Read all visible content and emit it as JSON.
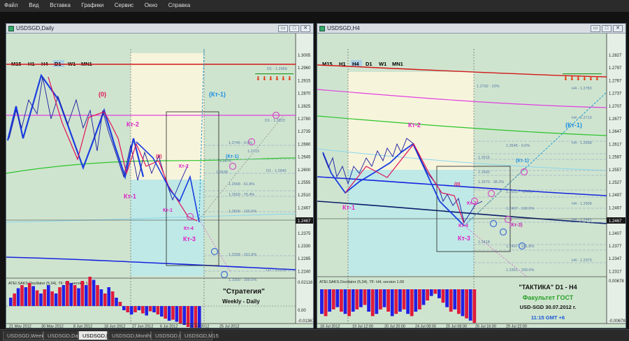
{
  "menu": [
    "Файл",
    "Вид",
    "Вставка",
    "Графики",
    "Сервис",
    "Окно",
    "Справка"
  ],
  "left_window": {
    "title": "USDSGD,Daily",
    "timeframes": [
      "M15",
      "H1",
      "H4",
      "D1",
      "W1",
      "MN1"
    ],
    "selected_tf": "D1",
    "price_labels": [
      "1.3005",
      "1.2960",
      "1.2915",
      "1.2870",
      "1.2825",
      "1.2780",
      "1.2735",
      "1.2690",
      "1.2645",
      "1.2600",
      "1.2555",
      "1.2510",
      "1.2467",
      "1.2420",
      "1.2375",
      "1.2330",
      "1.2285",
      "1.2240"
    ],
    "current_price": "1.2467",
    "date_labels": [
      "21 May 2012",
      "30 May 2012",
      "8 Jun 2012",
      "18 Jun 2012",
      "27 Jun 2012",
      "6 Jul 2012",
      "16 Jul 2012",
      "25 Jul 2012"
    ],
    "wave_labels": {
      "zero_top": "(0)",
      "kt2": "Кт-2",
      "zero_mid": "(0)",
      "kt2_small": "Кт-2",
      "kt1": "Кт-1",
      "kt1_small": "Кт-1",
      "kt3": "Кт-3",
      "kt4": "Кт-4",
      "kt1_bracket": "(Кт-1)",
      "kt1_bracket_small": "(Кт-1)"
    },
    "level_texts": [
      "D1 - 1.2969",
      "D1 - 1.2823",
      "1.2746 - 0.0%",
      "1.2713",
      "1.2676",
      "1.2638",
      "D1 - 1.2640",
      "1.2568 - 61.8%",
      "1.2563 - 76.4%",
      "1.2500 - 100.0%",
      "1.2358 - 161.8%",
      "D1 - 1.2296",
      "1.2300 - 200.0%"
    ],
    "osc_title": "ATEI.SAKS.Oscillator (5,34), TF: D1, version 1.00",
    "osc_scale": [
      "0.02116",
      "0.00",
      "-0.01367"
    ],
    "strategy_line1": "\"Стратегия\"",
    "strategy_line2": "Weekly - Daily"
  },
  "right_window": {
    "title": "USDSGD,H4",
    "timeframes": [
      "M15",
      "H1",
      "H4",
      "D1",
      "W1",
      "MN1"
    ],
    "selected_tf": "H4",
    "price_labels": [
      "1.2827",
      "1.2797",
      "1.2767",
      "1.2737",
      "1.2707",
      "1.2677",
      "1.2647",
      "1.2617",
      "1.2587",
      "1.2557",
      "1.2527",
      "1.2497",
      "1.2467",
      "1.2437",
      "1.2407",
      "1.2377",
      "1.2347",
      "1.2317"
    ],
    "current_price": "1.2467",
    "date_labels": [
      "18 Jul 2012",
      "19 Jul 12:00",
      "20 Jul 20:00",
      "24 Jul 08:00",
      "25 Jul 08:00",
      "26 Jul 16:00",
      "29 Jul 22:00"
    ],
    "wave_labels": {
      "kt2": "Кт-2",
      "zero": "(0)",
      "kt2_small": "Кт-2",
      "kt1": "Кт-1",
      "kt1_bracket": "(Кт-1)",
      "kt1_bracket_small": "(Кт-1)",
      "kt3": "Кт-3",
      "kt4": "Кт-4",
      "kt3_bracket": "(Кт-3)"
    },
    "level_texts": [
      "H4 - 1.2783",
      "1.2792 - 23%",
      "H4 - 1.2713",
      "H4 - 1.2658",
      "1.2645 - 0.0%",
      "1.2615",
      "1.2593",
      "1.2570 - 38.2%",
      "1.2551 - 76.4%",
      "H4 - 1.2509",
      "1.2497 - 100.0%",
      "H4 - 1.2441",
      "1.2418",
      "1.2407 - 161.8%",
      "H4 - 1.2373",
      "1.2351 - 200.0%"
    ],
    "osc_title": "ATEI.SAKS.Oscillator (5,34), TF: H4, version 1.00",
    "osc_scale": [
      "0.00678",
      "-0.00678"
    ],
    "info": {
      "line1": "\"ТАКТИКА\"   D1 - H4",
      "line2": "Факультет ГОСТ",
      "line3": "USD-SGD   30.07.2012 г.",
      "line4": "11:15   GMT +6"
    }
  },
  "tabs": [
    "USDSGD,Weekly",
    "USDSGD,Daily",
    "USDSGD,H4",
    "USDSGD,Monthly",
    "USDSGD,H1",
    "USDSGD,M15"
  ],
  "active_tab": "USDSGD,H4",
  "colors": {
    "bg": "#cfe4cf",
    "wave_blue": "#1a3ee0",
    "wave_red": "#e0135a",
    "label_magenta": "#e020c8",
    "label_cyan": "#1e90e0",
    "osc_blue": "#2121e6",
    "osc_red": "#e01a3c"
  }
}
